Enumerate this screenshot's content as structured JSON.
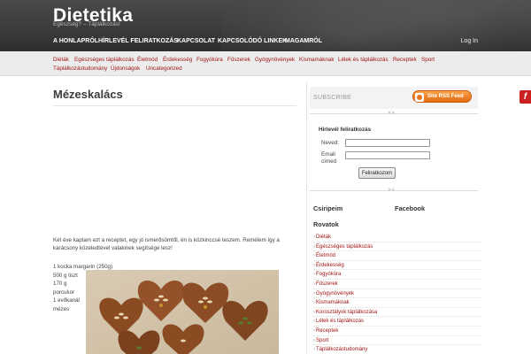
{
  "site": {
    "title": "Dietetika",
    "tagline": "Egészség? – Táplálkozás!"
  },
  "main_nav": {
    "items": [
      "A HONLAPRÓL",
      "HÍRLEVÉL FELIRATKOZÁS",
      "KAPCSOLAT",
      "KAPCSOLÓDÓ LINKEK",
      "MAGAMRÓL"
    ],
    "login": "Log In"
  },
  "categories": [
    "Diéták",
    "Egészséges táplálkozás",
    "Életmód",
    "Érdekesség",
    "Fogyókúra",
    "Fűszerek",
    "Gyógynövények",
    "Kismamáknak",
    "Lélek és táplálkozás",
    "Receptek",
    "Sport",
    "Táplálkozástudomány",
    "Újdonságok",
    "Uncategorized"
  ],
  "post": {
    "title": "Mézeskalács",
    "intro": "Két éve kaptam ezt a receptet, egy jó ismerősömtől, én is közkinccsé teszem. Remélem így a karácsony közeledtével valakinek segítsége lesz!",
    "ingredients": [
      "1 kocka margarin (250g)",
      "500 g liszt",
      "170 g",
      "porcukor",
      "1 evőkanál",
      "mézes"
    ]
  },
  "sidebar": {
    "subscribe_label": "SUBSCRIBE",
    "rss_button": "Site RSS Feed",
    "newsletter": {
      "title": "Hírlevél feliratkozás",
      "name_label": "Neved:",
      "email_label": "Email címed",
      "name_value": "",
      "email_value": "",
      "submit": "Feliratkozom"
    },
    "csiripeim": "Csiripeim",
    "facebook": "Facebook",
    "rovatok_title": "Rovatok",
    "rovatok": [
      "Diéták",
      "Egészséges táplálkozás",
      "Életmód",
      "Érdekesség",
      "Fogyókúra",
      "Fűszerek",
      "Gyógynövények",
      "Kismamáknak",
      "Korosztályok táplálkozása",
      "Lélek és táplálkozás",
      "Receptek",
      "Sport",
      "Táplálkozástudomány"
    ]
  },
  "icons": {
    "rss": "rss-icon",
    "flash": "flash-icon"
  },
  "colors": {
    "link": "#a01515",
    "header": "#3a3a3a",
    "rss": "#e36a10"
  }
}
